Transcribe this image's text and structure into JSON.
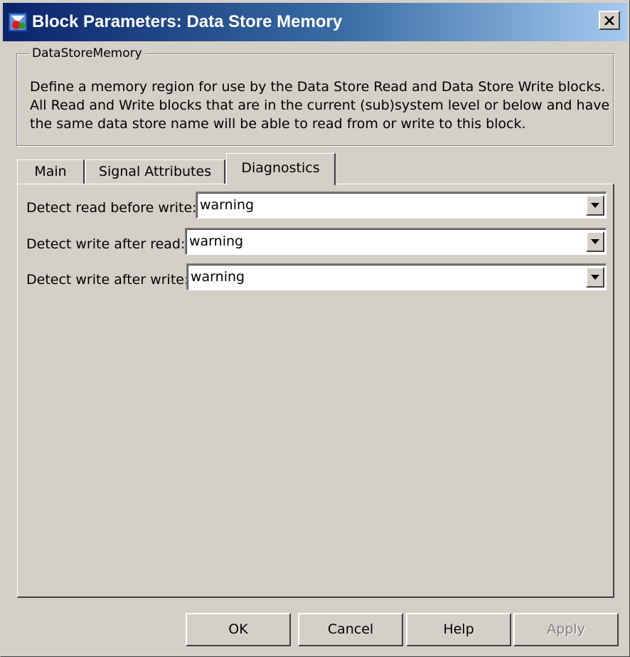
{
  "window": {
    "title": "Block Parameters: Data Store Memory",
    "icon": "simulink-block-icon",
    "close_symbol": "×"
  },
  "group": {
    "title": "DataStoreMemory",
    "description_lines": [
      "Define a memory region for use by the Data Store Read and Data Store Write blocks.",
      "All Read and Write blocks that are in the current (sub)system level or below and have",
      "the same data store name will be able to read from or write to this block."
    ]
  },
  "tabs": [
    {
      "label": "Main",
      "active": false
    },
    {
      "label": "Signal Attributes",
      "active": false
    },
    {
      "label": "Diagnostics",
      "active": true
    }
  ],
  "diagnostics": {
    "rows": [
      {
        "label": "Detect read before write:",
        "value": "warning"
      },
      {
        "label": "Detect write after read:",
        "value": "warning"
      },
      {
        "label": "Detect write after write:",
        "value": "warning"
      }
    ]
  },
  "buttons": {
    "ok": "OK",
    "cancel": "Cancel",
    "help": "Help",
    "apply": "Apply"
  },
  "colors": {
    "titlebar_start": "#0a246a",
    "titlebar_end": "#a6caf0",
    "face": "#d4d0c8"
  }
}
